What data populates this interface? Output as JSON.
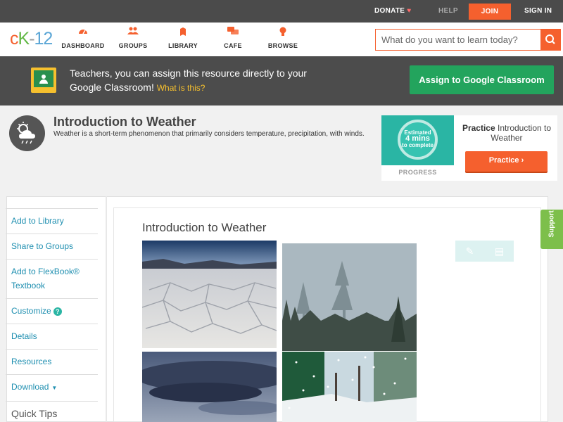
{
  "topbar": {
    "donate": "DONATE",
    "help": "HELP",
    "join": "JOIN",
    "signin": "SIGN IN"
  },
  "header": {
    "logo": {
      "c": "c",
      "k": "K",
      "dash": "-",
      "num": "12"
    },
    "nav": [
      {
        "label": "DASHBOARD",
        "icon": "dashboard-icon"
      },
      {
        "label": "GROUPS",
        "icon": "groups-icon"
      },
      {
        "label": "LIBRARY",
        "icon": "library-icon"
      },
      {
        "label": "CAFE",
        "icon": "cafe-icon"
      },
      {
        "label": "BROWSE",
        "icon": "lightbulb-icon"
      }
    ],
    "search_placeholder": "What do you want to learn today?"
  },
  "banner": {
    "text": "Teachers, you can assign this resource directly to your Google Classroom!",
    "what_link": "What is this?",
    "assign_button": "Assign to Google Classroom"
  },
  "lesson": {
    "title": "Introduction to Weather",
    "description": "Weather is a short-term phenomenon that primarily considers temperature, precipitation, with winds."
  },
  "practice": {
    "estimate_line1": "Estimated",
    "estimate_line2": "4 mins",
    "estimate_line3": "to complete",
    "progress_label": "PROGRESS",
    "title_bold": "Practice",
    "title_rest": "Introduction to Weather",
    "button": "Practice"
  },
  "sidebar": {
    "items": [
      "Add to Library",
      "Share to Groups",
      "Add to FlexBook® Textbook",
      "Customize",
      "Details",
      "Resources",
      "Download",
      "Quick Tips"
    ]
  },
  "content": {
    "title": "Introduction to Weather"
  },
  "support": "Support",
  "colors": {
    "brand_orange": "#f5602e",
    "classroom_green": "#23a45d",
    "link_blue": "#1f8fb0",
    "support_green": "#7dbf4b"
  }
}
